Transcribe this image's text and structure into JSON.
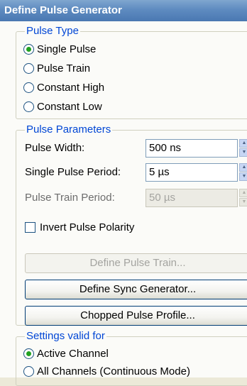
{
  "window": {
    "title": "Define Pulse Generator"
  },
  "pulse_type": {
    "legend": "Pulse Type",
    "options": [
      {
        "label": "Single Pulse",
        "selected": true
      },
      {
        "label": "Pulse Train",
        "selected": false
      },
      {
        "label": "Constant High",
        "selected": false
      },
      {
        "label": "Constant Low",
        "selected": false
      }
    ]
  },
  "pulse_parameters": {
    "legend": "Pulse Parameters",
    "pulse_width": {
      "label": "Pulse Width:",
      "value": "500 ns",
      "enabled": true
    },
    "single_pulse_period": {
      "label": "Single Pulse Period:",
      "value": "5 µs",
      "enabled": true
    },
    "pulse_train_period": {
      "label": "Pulse Train Period:",
      "value": "50 µs",
      "enabled": false
    },
    "invert_polarity": {
      "label": "Invert Pulse Polarity",
      "checked": false
    },
    "buttons": {
      "define_pulse_train": "Define Pulse Train...",
      "define_sync_generator": "Define Sync Generator...",
      "chopped_pulse_profile": "Chopped Pulse Profile..."
    }
  },
  "settings_valid_for": {
    "legend": "Settings valid for",
    "options": [
      {
        "label": "Active Channel",
        "selected": true
      },
      {
        "label": "All Channels (Continuous Mode)",
        "selected": false
      }
    ]
  }
}
